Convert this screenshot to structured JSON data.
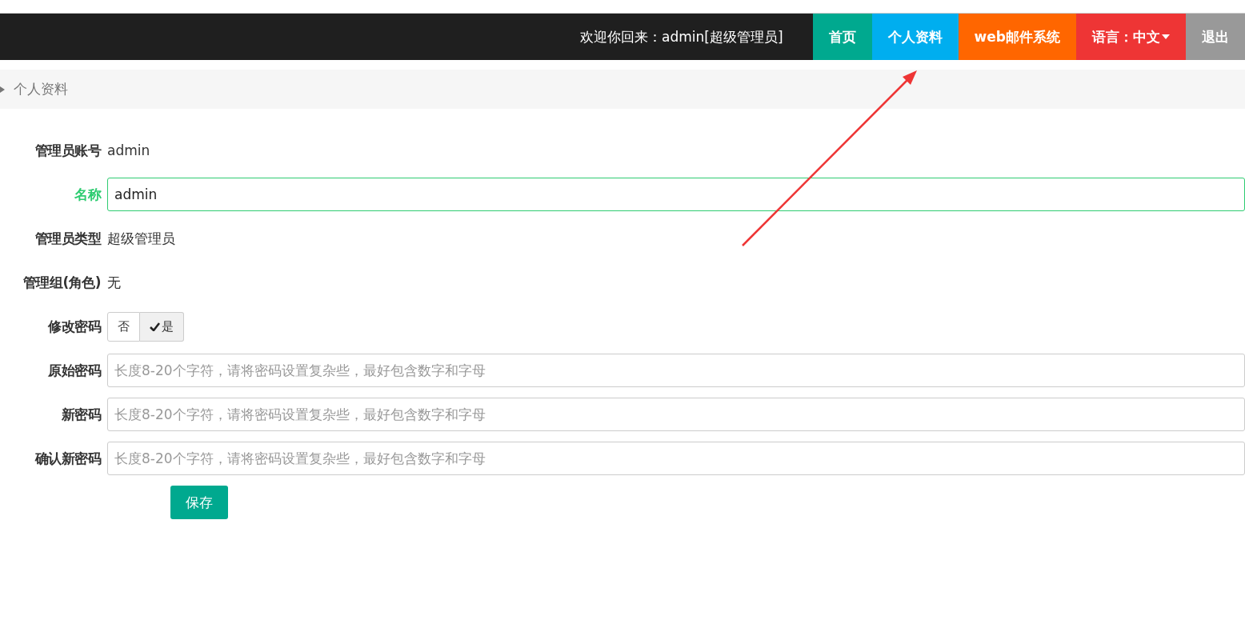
{
  "topbar": {
    "welcome": "欢迎你回来：admin[超级管理员]",
    "nav": [
      {
        "label": "首页",
        "color": "#00a98f",
        "dropdown": false
      },
      {
        "label": "个人资料",
        "color": "#00aeef",
        "dropdown": false
      },
      {
        "label": "web邮件系统",
        "color": "#ff6600",
        "dropdown": false
      },
      {
        "label": "语言：中文",
        "color": "#ee3535",
        "dropdown": true
      },
      {
        "label": "退出",
        "color": "#999999",
        "dropdown": false
      }
    ]
  },
  "breadcrumb": "个人资料",
  "form": [
    {
      "kind": "text",
      "label": "管理员账号",
      "value": "admin"
    },
    {
      "kind": "input",
      "label": "名称",
      "value": "admin",
      "focused": true
    },
    {
      "kind": "text",
      "label": "管理员类型",
      "value": "超级管理员"
    },
    {
      "kind": "text",
      "label": "管理组(角色)",
      "value": "无"
    },
    {
      "kind": "toggle",
      "label": "修改密码",
      "options": [
        {
          "label": "否",
          "selected": false
        },
        {
          "label": "是",
          "selected": true
        }
      ]
    },
    {
      "kind": "input",
      "label": "原始密码",
      "placeholder": "长度8-20个字符，请将密码设置复杂些，最好包含数字和字母",
      "focused": false
    },
    {
      "kind": "input",
      "label": "新密码",
      "placeholder": "长度8-20个字符，请将密码设置复杂些，最好包含数字和字母",
      "focused": false
    },
    {
      "kind": "input",
      "label": "确认新密码",
      "placeholder": "长度8-20个字符，请将密码设置复杂些，最好包含数字和字母",
      "focused": false
    }
  ],
  "save_button": "保存"
}
